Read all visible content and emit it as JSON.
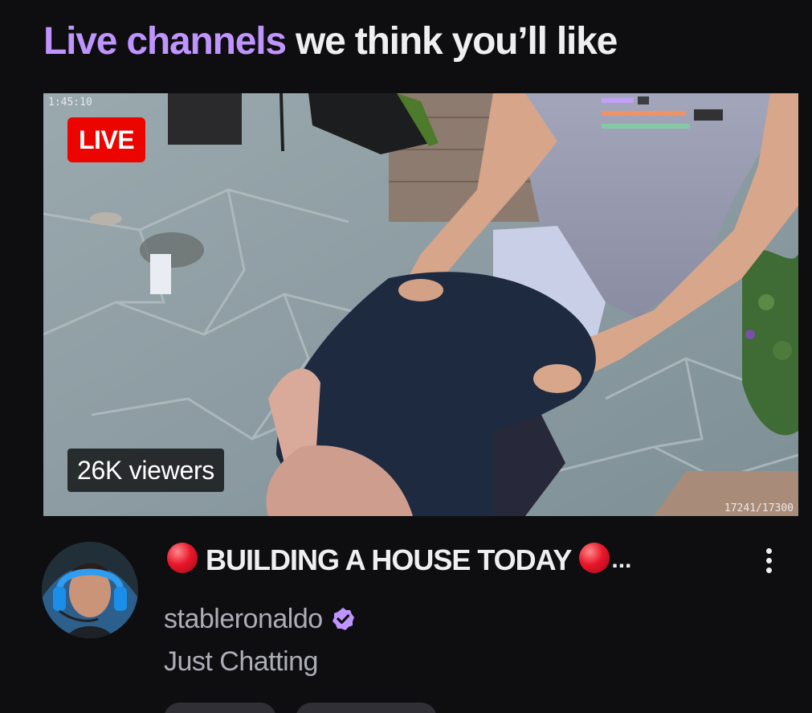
{
  "section": {
    "heading_accent": "Live channels",
    "heading_rest": " we think you’ll like"
  },
  "stream": {
    "live_label": "LIVE",
    "viewers": "26K viewers",
    "overlay_timestamp": "1:45:10",
    "overlay_counter": "17241/17300",
    "title": "BUILDING A HOUSE TODAY",
    "title_ellipsis": "...",
    "channel": "stableronaldo",
    "category": "Just Chatting"
  },
  "colors": {
    "accent": "#bf94ff",
    "live_red": "#eb0400",
    "background": "#0e0e10",
    "text_primary": "#efeff1",
    "text_secondary": "#adadb8"
  },
  "icons": {
    "title_prefix": "red-circle-icon",
    "title_suffix": "red-circle-icon",
    "verified": "verified-badge-icon",
    "menu": "more-vertical-icon"
  }
}
